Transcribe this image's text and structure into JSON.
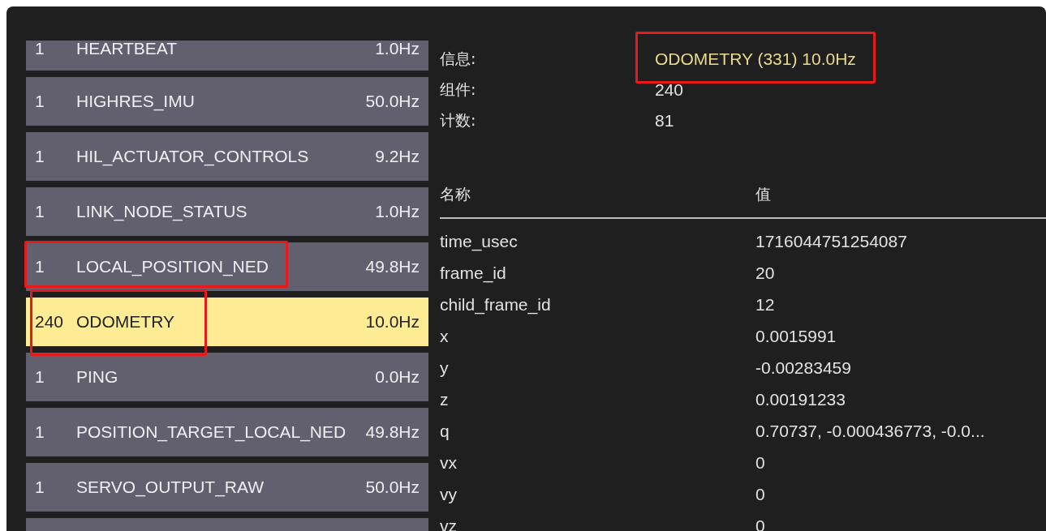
{
  "messages": [
    {
      "component": "1",
      "name": "HEARTBEAT",
      "rate": "1.0Hz",
      "selected": false,
      "annotated": false
    },
    {
      "component": "1",
      "name": "HIGHRES_IMU",
      "rate": "50.0Hz",
      "selected": false,
      "annotated": false
    },
    {
      "component": "1",
      "name": "HIL_ACTUATOR_CONTROLS",
      "rate": "9.2Hz",
      "selected": false,
      "annotated": false
    },
    {
      "component": "1",
      "name": "LINK_NODE_STATUS",
      "rate": "1.0Hz",
      "selected": false,
      "annotated": false
    },
    {
      "component": "1",
      "name": "LOCAL_POSITION_NED",
      "rate": "49.8Hz",
      "selected": false,
      "annotated": true
    },
    {
      "component": "240",
      "name": "ODOMETRY",
      "rate": "10.0Hz",
      "selected": true,
      "annotated": true
    },
    {
      "component": "1",
      "name": "PING",
      "rate": "0.0Hz",
      "selected": false,
      "annotated": false
    },
    {
      "component": "1",
      "name": "POSITION_TARGET_LOCAL_NED",
      "rate": "49.8Hz",
      "selected": false,
      "annotated": false
    },
    {
      "component": "1",
      "name": "SERVO_OUTPUT_RAW",
      "rate": "50.0Hz",
      "selected": false,
      "annotated": false
    }
  ],
  "info": [
    {
      "label": "信息:",
      "value": "ODOMETRY (331) 10.0Hz",
      "kind": "title",
      "annotated": true
    },
    {
      "label": "组件:",
      "value": "240",
      "kind": "plain",
      "annotated": false
    },
    {
      "label": "计数:",
      "value": "81",
      "kind": "plain",
      "annotated": false
    }
  ],
  "fields": {
    "columns": [
      "名称",
      "值"
    ],
    "rows": [
      {
        "name": "time_usec",
        "value": "1716044751254087"
      },
      {
        "name": "frame_id",
        "value": "20"
      },
      {
        "name": "child_frame_id",
        "value": "12"
      },
      {
        "name": "x",
        "value": "0.0015991"
      },
      {
        "name": "y",
        "value": "-0.00283459"
      },
      {
        "name": "z",
        "value": "0.00191233"
      },
      {
        "name": "q",
        "value": "0.70737, -0.000436773, -0.0..."
      },
      {
        "name": "vx",
        "value": "0"
      },
      {
        "name": "vy",
        "value": "0"
      },
      {
        "name": "vz",
        "value": "0"
      }
    ]
  }
}
